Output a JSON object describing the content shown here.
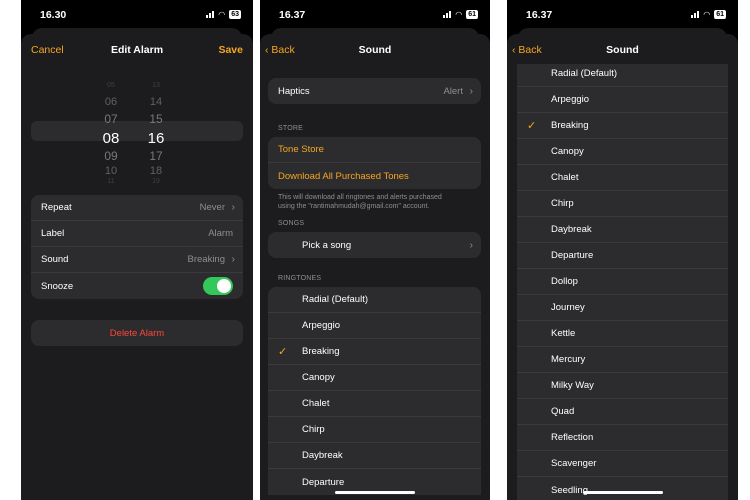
{
  "colors": {
    "accent": "#f5a623",
    "toggle_on": "#34c759",
    "destructive": "#ff453a"
  },
  "phone1": {
    "time": "16.30",
    "battery": "63",
    "nav": {
      "cancel": "Cancel",
      "title": "Edit Alarm",
      "save": "Save"
    },
    "picker": {
      "hours": [
        "05",
        "06",
        "07",
        "08",
        "09",
        "10",
        "11"
      ],
      "minutes": [
        "13",
        "14",
        "15",
        "16",
        "17",
        "18",
        "19"
      ],
      "selected_hour": "08",
      "selected_minute": "16"
    },
    "settings": [
      {
        "label": "Repeat",
        "value": "Never"
      },
      {
        "label": "Label",
        "value": "Alarm"
      },
      {
        "label": "Sound",
        "value": "Breaking"
      },
      {
        "label": "Snooze",
        "toggle": true
      }
    ],
    "delete": "Delete Alarm"
  },
  "phone2": {
    "time": "16.37",
    "battery": "61",
    "nav": {
      "back": "Back",
      "title": "Sound"
    },
    "haptics": {
      "label": "Haptics",
      "value": "Alert"
    },
    "store_header": "STORE",
    "tone_store": "Tone Store",
    "download_all": "Download All Purchased Tones",
    "store_footer_1": "This will download all ringtones and alerts purchased",
    "store_footer_2": "using the \"rantimahmudah@gmail.com\" account.",
    "songs_header": "SONGS",
    "pick_song": "Pick a song",
    "ringtones_header": "RINGTONES",
    "ringtones": [
      "Radial (Default)",
      "Arpeggio",
      "Breaking",
      "Canopy",
      "Chalet",
      "Chirp",
      "Daybreak",
      "Departure"
    ],
    "selected": "Breaking"
  },
  "phone3": {
    "time": "16.37",
    "battery": "61",
    "nav": {
      "back": "Back",
      "title": "Sound"
    },
    "ringtones": [
      "Radial (Default)",
      "Arpeggio",
      "Breaking",
      "Canopy",
      "Chalet",
      "Chirp",
      "Daybreak",
      "Departure",
      "Dollop",
      "Journey",
      "Kettle",
      "Mercury",
      "Milky Way",
      "Quad",
      "Reflection",
      "Scavenger",
      "Seedling"
    ],
    "selected": "Breaking"
  }
}
